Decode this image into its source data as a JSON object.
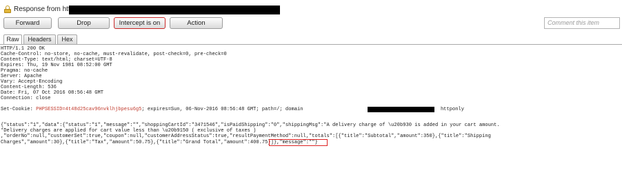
{
  "window": {
    "title": "Response from https"
  },
  "toolbar": {
    "forward_label": "Forward",
    "drop_label": "Drop",
    "intercept_label": "Intercept is on",
    "action_label": "Action",
    "comment_placeholder": "Comment this item"
  },
  "tabs": {
    "raw": "Raw",
    "headers": "Headers",
    "hex": "Hex",
    "selected": "Raw"
  },
  "response": {
    "status_line": "HTTP/1.1 200 OK",
    "headers": [
      "Cache-Control: no-store, no-cache, must-revalidate, post-check=0, pre-check=0",
      "Content-Type: text/html; charset=UTF-8",
      "Expires: Thu, 19 Nov 1981 08:52:00 GMT",
      "Pragma: no-cache",
      "Server: Apache",
      "Vary: Accept-Encoding",
      "Content-Length: 536",
      "Date: Fri, 07 Oct 2016 08:56:48 GMT",
      "Connection: close"
    ],
    "set_cookie": {
      "prefix": "Set-Cookie: ",
      "cookie": "PHPSESSID=4t48d25cav96nvklhjbpesu6g5",
      "middle": "; expires=Sun, 06-Nov-2016 08:56:48 GMT; path=/; domain",
      "suffix": "httponly"
    },
    "body_lines": {
      "l1": "{\"status\":\"1\",\"data\":{\"status\":\"1\",\"message\":\"\",\"shoppingCartId\":\"3471546\",\"isPaidShipping\":\"0\",\"shippingMsg\":\"A delivery charge of \\u20b930 is added in your cart amount.",
      "l2": "*Delivery charges are applied for cart value less than \\u20b9150 ( exclusive of taxes )",
      "l3": ",\"orderNo\":null,\"customerSet\":true,\"coupon\":null,\"customerAddressStatus\":true,\"resultPaymentMethod\":null,\"totals\":[{\"title\":\"Subtotal\",\"amount\":350},{\"title\":\"Shipping",
      "l4a": "Charges\",\"amount\":30},{\"title\":\"Tax\",\"amount\":50.75},{\"title\":\"Grand Total\",",
      "l4b": "\"amount\":400.75}]",
      "l4c": "},\"message\":\"\"}"
    }
  },
  "colors": {
    "intercept_border": "#c92626",
    "cookie_value": "#c0392b",
    "highlight_box": "#dd2222"
  }
}
